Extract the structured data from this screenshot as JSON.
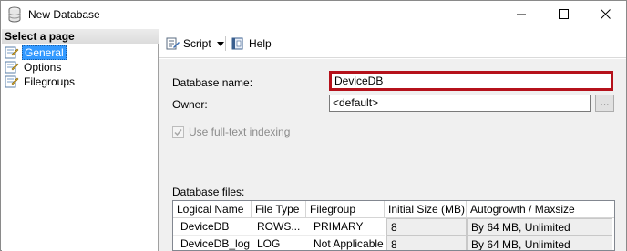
{
  "window": {
    "title": "New Database",
    "controls": {
      "minimize": "minimize",
      "maximize": "maximize",
      "close": "close"
    }
  },
  "sidebar": {
    "header": "Select a page",
    "items": [
      {
        "label": "General",
        "icon": "page-wrench-icon",
        "selected": true
      },
      {
        "label": "Options",
        "icon": "page-wrench-icon",
        "selected": false
      },
      {
        "label": "Filegroups",
        "icon": "page-wrench-icon",
        "selected": false
      }
    ]
  },
  "toolbar": {
    "script_label": "Script",
    "help_label": "Help"
  },
  "form": {
    "database_name_label": "Database name:",
    "database_name_value": "DeviceDB",
    "owner_label": "Owner:",
    "owner_value": "<default>",
    "browse_label": "...",
    "fulltext_label": "Use full-text indexing",
    "fulltext_checked": true,
    "fulltext_enabled": false,
    "files_label": "Database files:"
  },
  "grid": {
    "columns": [
      "Logical Name",
      "File Type",
      "Filegroup",
      "Initial Size (MB)",
      "Autogrowth / Maxsize"
    ],
    "rows": [
      [
        "DeviceDB",
        "ROWS...",
        "PRIMARY",
        "8",
        "By 64 MB, Unlimited"
      ],
      [
        "DeviceDB_log",
        "LOG",
        "Not Applicable",
        "8",
        "By 64 MB, Unlimited"
      ]
    ]
  },
  "colors": {
    "highlight_border": "#b5111b",
    "selection": "#3399ff",
    "content_bg": "#f0f0f0"
  }
}
